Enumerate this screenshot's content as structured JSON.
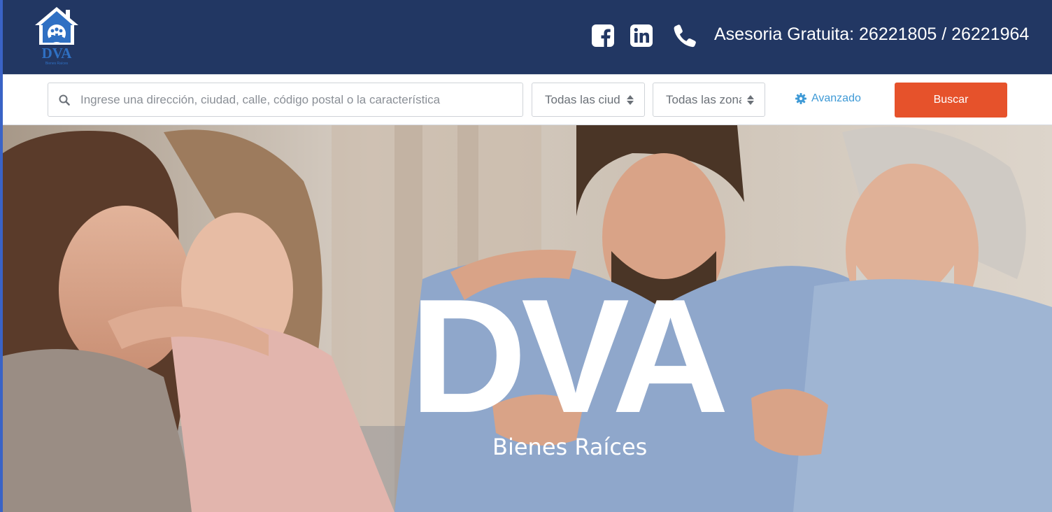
{
  "header": {
    "logo_text": "DVA",
    "logo_subtext": "Bienes Raíces",
    "social": [
      {
        "name": "facebook-icon"
      },
      {
        "name": "linkedin-icon"
      },
      {
        "name": "phone-icon"
      }
    ],
    "contact_text": "Asesoria Gratuita: 26221805 / 26221964",
    "colors": {
      "bar": "#223763",
      "text": "#ffffff"
    }
  },
  "search": {
    "icon": "search-icon",
    "placeholder": "Ingrese una dirección, ciudad, calle, código postal o la característica",
    "value": "",
    "city_select": "Todas las ciudades",
    "zone_select": "Todas las zonas",
    "advanced_icon": "gear-icon",
    "advanced_label": "Avanzado",
    "button_label": "Buscar",
    "colors": {
      "button": "#e6522b",
      "advanced": "#3f9ad6"
    }
  },
  "hero": {
    "brand": "DVA",
    "tagline": "Bienes Raíces"
  }
}
